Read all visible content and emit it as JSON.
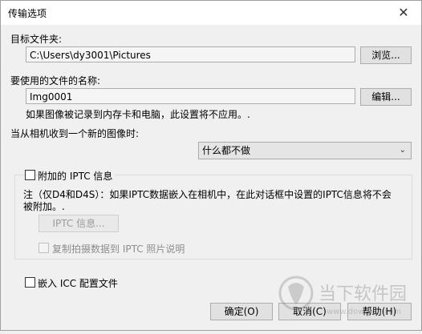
{
  "window": {
    "title": "传输选项",
    "close_glyph": "✕"
  },
  "target_folder": {
    "label": "目标文件夹:",
    "value": "C:\\Users\\dy3001\\Pictures",
    "browse_label": "浏览..."
  },
  "file_name": {
    "label": "要使用的文件的名称:",
    "value": "Img0001",
    "edit_label": "编辑...",
    "note": "如果图像被记录到内存卡和电脑，此设置将不应用。."
  },
  "on_receive": {
    "label": "当从相机收到一个新的图像时:",
    "selected": "什么都不做"
  },
  "iptc": {
    "checkbox_label": "附加的 IPTC 信息",
    "checked": false,
    "note_line1": "注（仅D4和D4S）：如果IPTC数据嵌入在相机中，在此对话框中设置的IPTC信息将不会",
    "note_line2": "被附加。.",
    "info_button": "IPTC 信息...",
    "copy_label": "复制拍摄数据到 IPTC 照片说明"
  },
  "icc": {
    "checkbox_label": "嵌入 ICC 配置文件",
    "checked": false
  },
  "buttons": {
    "ok": "确定(O)",
    "cancel": "取消(C)",
    "help": "帮助(H)"
  },
  "watermark": {
    "text": "当下软件园",
    "url": "www.downxia.com"
  }
}
